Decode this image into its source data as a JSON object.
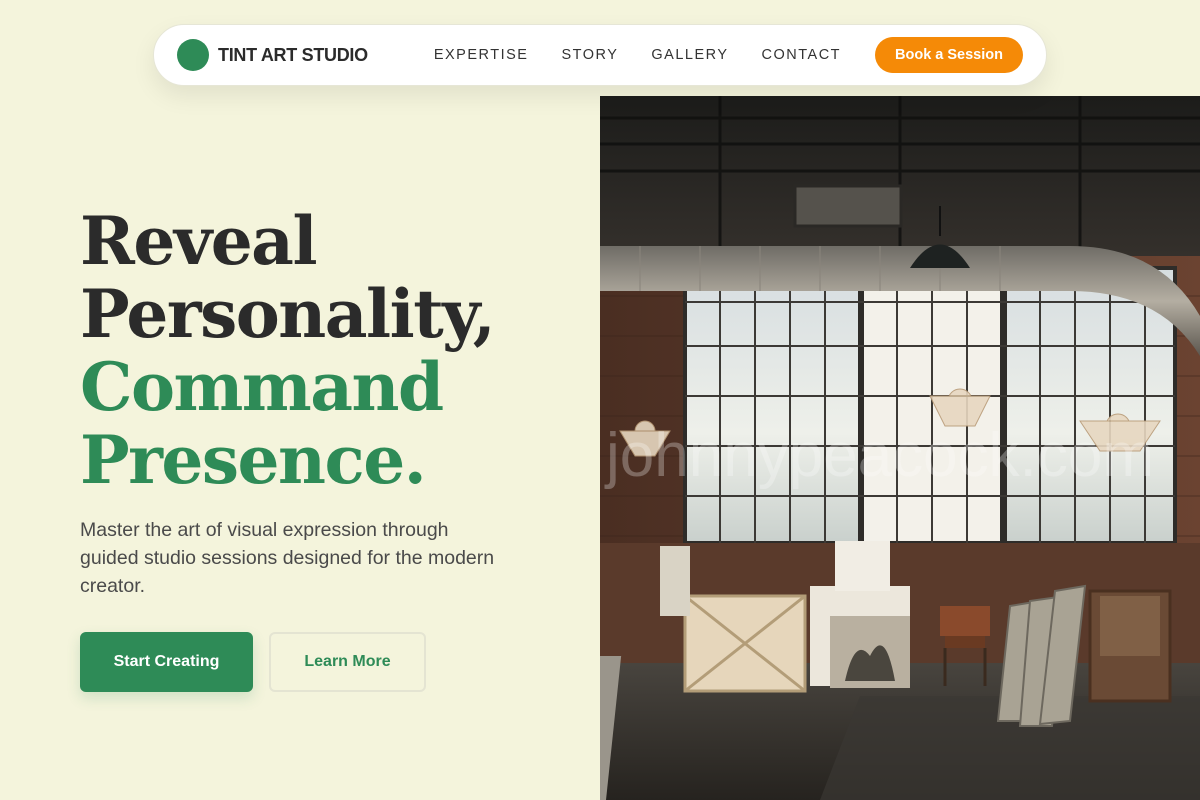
{
  "brand": {
    "name": "TINT ART STUDIO",
    "logo_color": "#2e8b57"
  },
  "nav": {
    "links": [
      "EXPERTISE",
      "STORY",
      "GALLERY",
      "CONTACT"
    ],
    "cta_label": "Book a Session"
  },
  "hero": {
    "headline_dark": [
      "Reveal",
      "Personality,"
    ],
    "headline_green": [
      "Command",
      "Presence."
    ],
    "subtitle": "Master the art of visual expression through guided studio sessions designed for the modern creator.",
    "primary_button": "Start Creating",
    "secondary_button": "Learn More"
  },
  "image": {
    "watermark": "johnnypeacock.com"
  },
  "colors": {
    "background": "#f4f4dc",
    "accent_green": "#2e8b57",
    "accent_orange": "#f58a07",
    "text_dark": "#2b2b2b"
  }
}
